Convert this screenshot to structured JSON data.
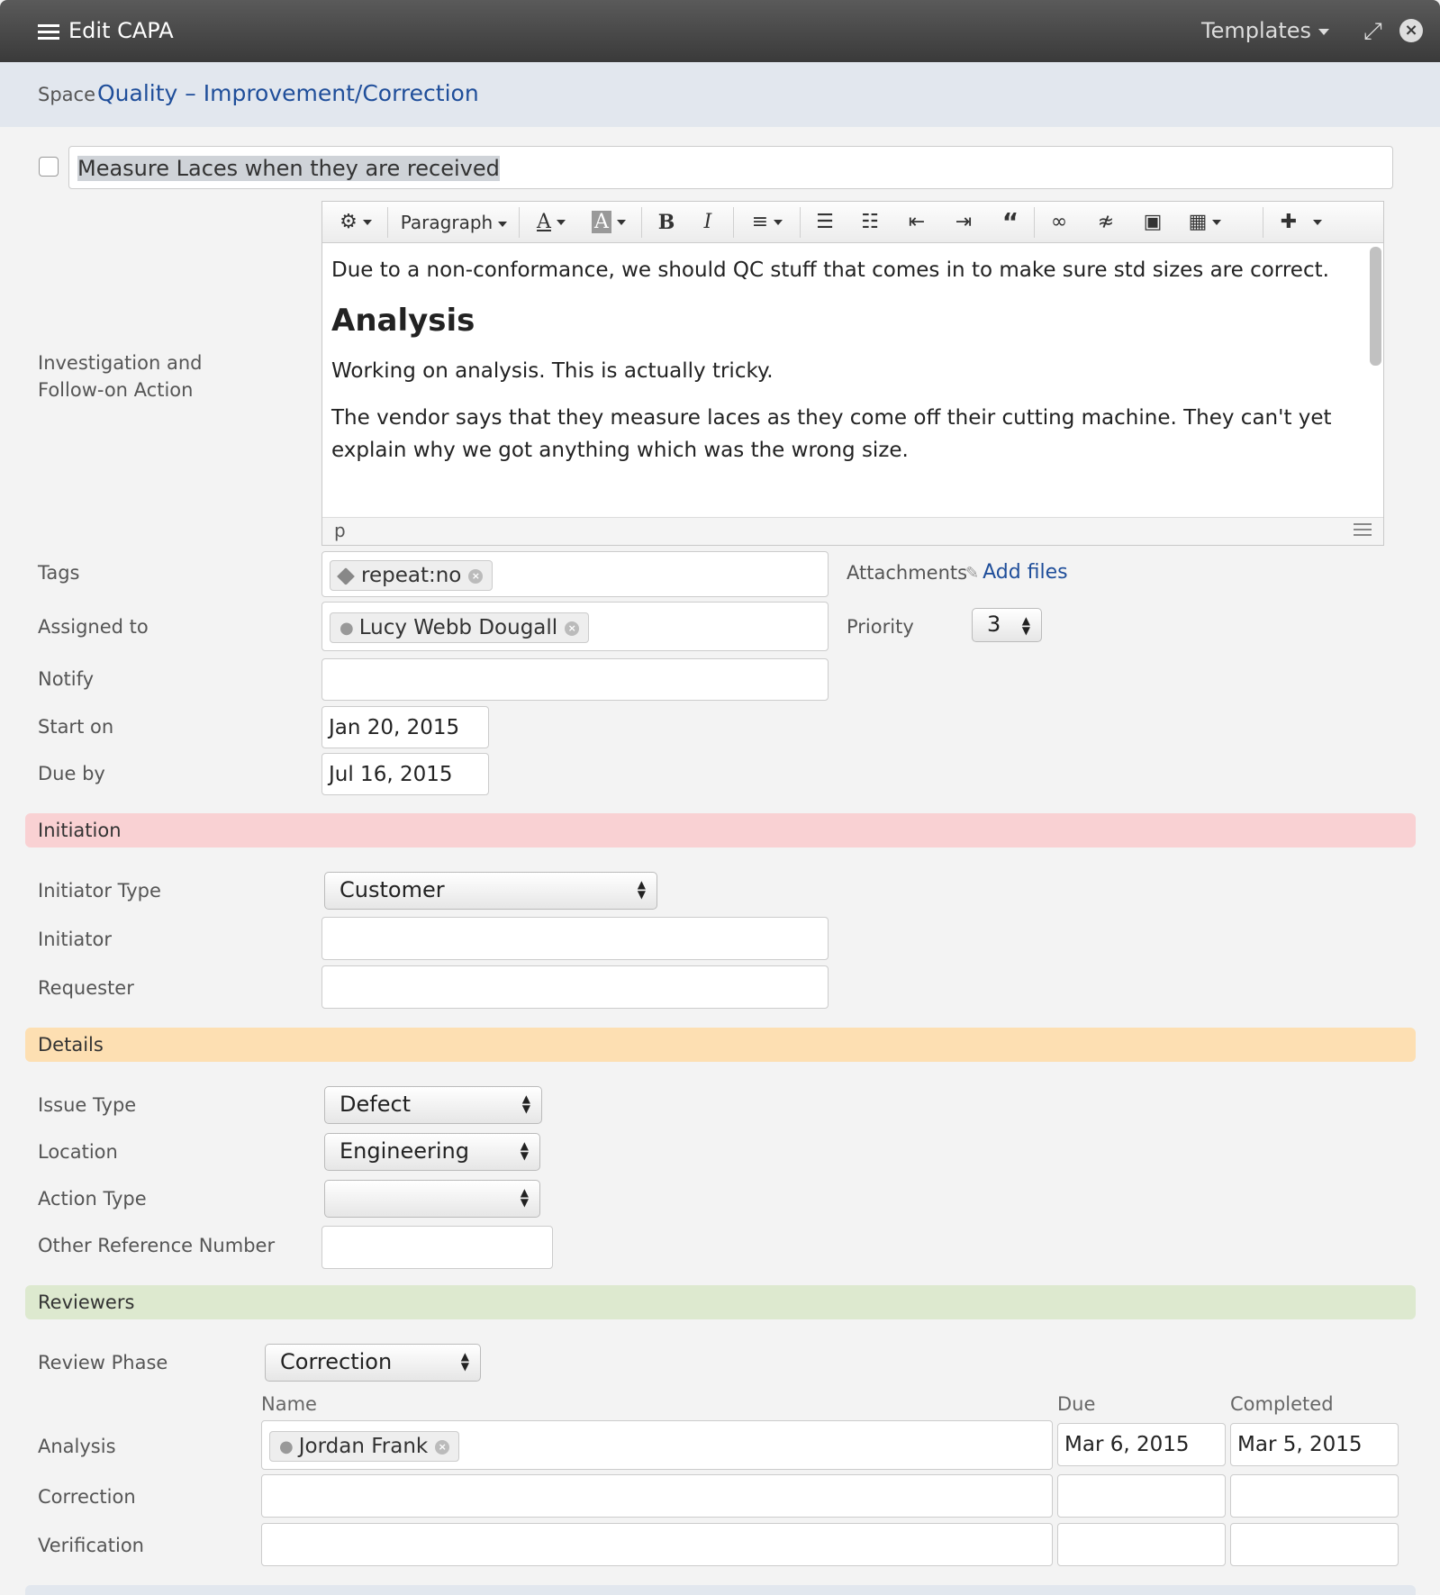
{
  "window": {
    "title": "Edit CAPA",
    "templates_label": "Templates"
  },
  "space": {
    "label": "Space",
    "value": "Quality – Improvement/Correction"
  },
  "item": {
    "title": "Measure Laces when they are received"
  },
  "editor": {
    "label": "Investigation and Follow-on Action",
    "label_line1": "Investigation and",
    "label_line2": "Follow-on Action",
    "toolbar": {
      "paragraph": "Paragraph"
    },
    "content": {
      "p1": "Due to a non-conformance, we should QC stuff that comes in to make sure std sizes are correct.",
      "heading": "Analysis",
      "p2": "Working on analysis. This is actually tricky.",
      "p3": "The vendor says that they measure laces as they come off their cutting machine. They can't yet explain why we got anything which was the wrong size."
    },
    "status_path": "p"
  },
  "tags": {
    "label": "Tags",
    "chip": "repeat:no"
  },
  "attachments": {
    "label": "Attachments",
    "link": "Add files"
  },
  "assigned": {
    "label": "Assigned to",
    "chip": "Lucy Webb Dougall"
  },
  "priority": {
    "label": "Priority",
    "value": "3"
  },
  "notify": {
    "label": "Notify",
    "value": ""
  },
  "start": {
    "label": "Start on",
    "value": "Jan 20, 2015"
  },
  "due": {
    "label": "Due by",
    "value": "Jul 16, 2015"
  },
  "sections": {
    "initiation": {
      "label": "Initiation",
      "color": "#f9d1d3"
    },
    "details": {
      "label": "Details",
      "color": "#fddfb2"
    },
    "reviewers": {
      "label": "Reviewers",
      "color": "#dde9cf"
    }
  },
  "initiation": {
    "type_label": "Initiator Type",
    "type_value": "Customer",
    "initiator_label": "Initiator",
    "requester_label": "Requester"
  },
  "details": {
    "issue_label": "Issue Type",
    "issue_value": "Defect",
    "location_label": "Location",
    "location_value": "Engineering",
    "action_label": "Action Type",
    "action_value": "",
    "ref_label": "Other Reference Number"
  },
  "reviewers": {
    "phase_label": "Review Phase",
    "phase_value": "Correction",
    "col_name": "Name",
    "col_due": "Due",
    "col_completed": "Completed",
    "rows": [
      {
        "label": "Analysis",
        "name": "Jordan Frank",
        "due": "Mar 6, 2015",
        "completed": "Mar 5, 2015"
      },
      {
        "label": "Correction",
        "name": "",
        "due": "",
        "completed": ""
      },
      {
        "label": "Verification",
        "name": "",
        "due": "",
        "completed": ""
      }
    ]
  }
}
